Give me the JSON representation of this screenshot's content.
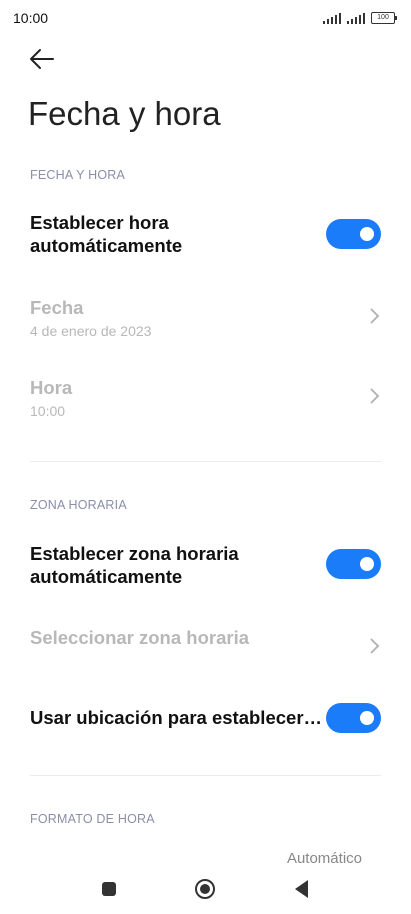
{
  "status_bar": {
    "time": "10:00",
    "battery": "100"
  },
  "header": {
    "title": "Fecha y hora",
    "back_icon": "arrow-left-icon"
  },
  "sections": {
    "date_time": {
      "header": "FECHA Y HORA",
      "auto_time": {
        "label_line1": "Establecer hora",
        "label_line2": "automáticamente",
        "enabled": true
      },
      "date": {
        "label": "Fecha",
        "value": "4 de enero de 2023"
      },
      "time": {
        "label": "Hora",
        "value": "10:00"
      }
    },
    "time_zone": {
      "header": "ZONA HORARIA",
      "auto_zone": {
        "label_line1": "Establecer zona horaria",
        "label_line2": "automáticamente",
        "enabled": true
      },
      "select_zone": {
        "label": "Seleccionar zona horaria"
      },
      "use_location": {
        "label": "Usar ubicación para establecer…",
        "enabled": true
      }
    },
    "time_format": {
      "header": "FORMATO DE HORA",
      "value": "Automático"
    }
  },
  "colors": {
    "accent": "#1a7cf8",
    "section_header": "#8a8ea8",
    "disabled_text": "#b8b8b8"
  }
}
